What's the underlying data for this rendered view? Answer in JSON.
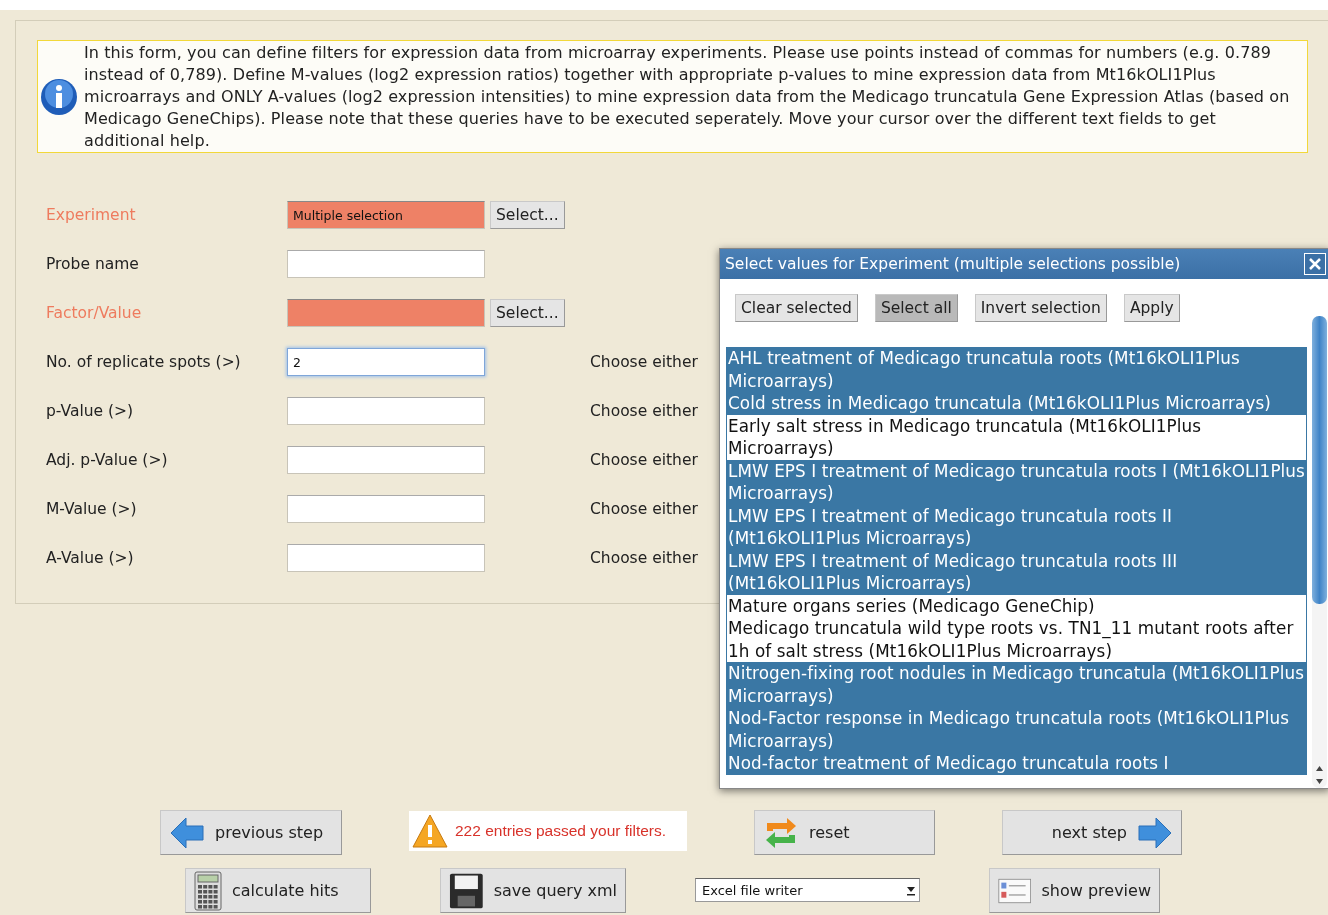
{
  "info": {
    "text": "In this form, you can define filters for expression data from microarray experiments. Please use points instead of commas for numbers (e.g. 0.789 instead of 0,789). Define M-values (log2 expression ratios) together with appropriate p-values to mine expression data from Mt16kOLI1Plus microarrays and ONLY A-values (log2 expression intensities) to mine expression data from the Medicago truncatula Gene Expression Atlas (based on Medicago GeneChips). Please note that these queries have to be executed seperately. Move your cursor over the different text fields to get additional help."
  },
  "fields": [
    {
      "label": "Experiment",
      "invalid": true,
      "focused": false,
      "value": "Multiple selection",
      "button": "Select..."
    },
    {
      "label": "Probe name",
      "invalid": false,
      "focused": false
    },
    {
      "label": "Factor/Value",
      "invalid": true,
      "focused": false,
      "button": "Select..."
    },
    {
      "label": "No. of replicate spots (>)",
      "invalid": false,
      "focused": true,
      "value": "2",
      "note": "Choose either"
    },
    {
      "label": "p-Value (>)",
      "invalid": false,
      "focused": false,
      "note": "Choose either"
    },
    {
      "label": "Adj. p-Value (>)",
      "invalid": false,
      "focused": false,
      "note": "Choose either"
    },
    {
      "label": "M-Value (>)",
      "invalid": false,
      "focused": false,
      "note": "Choose either"
    },
    {
      "label": "A-Value (>)",
      "invalid": false,
      "focused": false,
      "note": "Choose either"
    }
  ],
  "dialog": {
    "title": "Select values for Experiment (multiple selections possible)",
    "buttons": [
      {
        "label": "Clear selected",
        "pressed": false
      },
      {
        "label": "Select all",
        "pressed": true
      },
      {
        "label": "Invert selection",
        "pressed": false
      },
      {
        "label": "Apply",
        "pressed": false
      }
    ],
    "items": [
      {
        "label": "AHL treatment of Medicago truncatula roots (Mt16kOLI1Plus Microarrays)",
        "selected": true
      },
      {
        "label": "Cold stress in Medicago truncatula (Mt16kOLI1Plus Microarrays)",
        "selected": true
      },
      {
        "label": "Early salt stress in Medicago truncatula (Mt16kOLI1Plus Microarrays)",
        "selected": false
      },
      {
        "label": "LMW EPS I treatment of Medicago truncatula roots I (Mt16kOLI1Plus Microarrays)",
        "selected": true
      },
      {
        "label": "LMW EPS I treatment of Medicago truncatula roots II (Mt16kOLI1Plus Microarrays)",
        "selected": true
      },
      {
        "label": "LMW EPS I treatment of Medicago truncatula roots III (Mt16kOLI1Plus Microarrays)",
        "selected": true
      },
      {
        "label": "Mature organs series (Medicago GeneChip)",
        "selected": false
      },
      {
        "label": "Medicago truncatula wild type roots vs. TN1_11 mutant roots after 1h of salt stress (Mt16kOLI1Plus Microarrays)",
        "selected": false
      },
      {
        "label": "Nitrogen-fixing root nodules in Medicago truncatula (Mt16kOLI1Plus Microarrays)",
        "selected": true
      },
      {
        "label": "Nod-Factor response in Medicago truncatula roots (Mt16kOLI1Plus Microarrays)",
        "selected": true
      },
      {
        "label": "Nod-factor treatment of Medicago truncatula roots I",
        "selected": true
      }
    ]
  },
  "actions": {
    "previous": "previous step",
    "message": "222 entries passed your filters.",
    "reset": "reset",
    "next": "next step",
    "calculate": "calculate hits",
    "save": "save query xml",
    "writer": "Excel file writer",
    "preview": "show preview"
  }
}
